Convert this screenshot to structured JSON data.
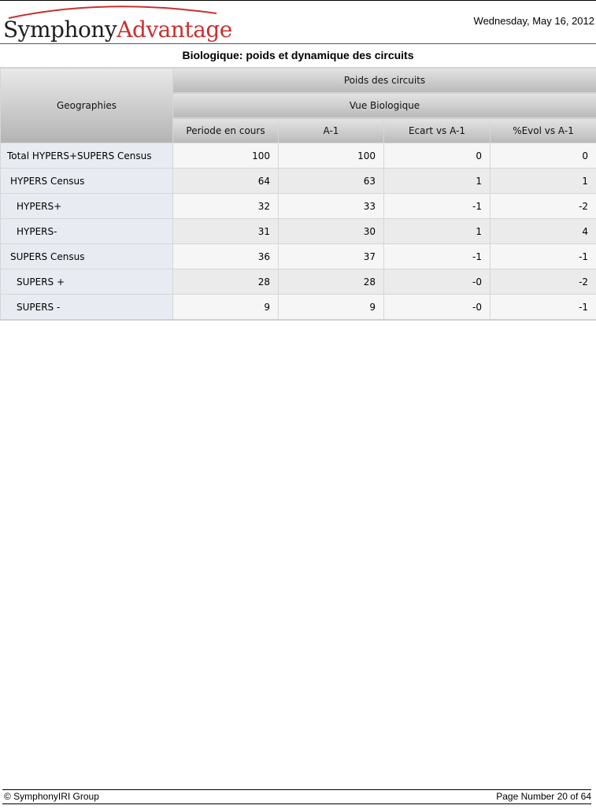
{
  "header": {
    "logo": {
      "part1": "Symphony",
      "part2": "Advantage"
    },
    "date": "Wednesday, May 16, 2012",
    "title": "Biologique: poids et dynamique des circuits"
  },
  "table": {
    "geo_header": "Geographies",
    "group_header": "Poids des circuits",
    "sub_header": "Vue Biologique",
    "columns": [
      "Periode en cours",
      "A-1",
      "Ecart vs A-1",
      "%Evol vs A-1"
    ],
    "rows": [
      {
        "label": "Total HYPERS+SUPERS Census",
        "values": [
          "100",
          "100",
          "0",
          "0"
        ]
      },
      {
        "label": "HYPERS Census",
        "values": [
          "64",
          "63",
          "1",
          "1"
        ]
      },
      {
        "label": "HYPERS+",
        "values": [
          "32",
          "33",
          "-1",
          "-2"
        ]
      },
      {
        "label": "HYPERS-",
        "values": [
          "31",
          "30",
          "1",
          "4"
        ]
      },
      {
        "label": "SUPERS Census",
        "values": [
          "36",
          "37",
          "-1",
          "-1"
        ]
      },
      {
        "label": "SUPERS +",
        "values": [
          "28",
          "28",
          "-0",
          "-2"
        ]
      },
      {
        "label": "SUPERS -",
        "values": [
          "9",
          "9",
          "-0",
          "-1"
        ]
      }
    ]
  },
  "footer": {
    "copyright": "© SymphonyIRI Group",
    "page": "Page Number 20 of 64"
  },
  "colors": {
    "brand_red": "#c8312f",
    "brand_dark": "#1f1f1f"
  }
}
